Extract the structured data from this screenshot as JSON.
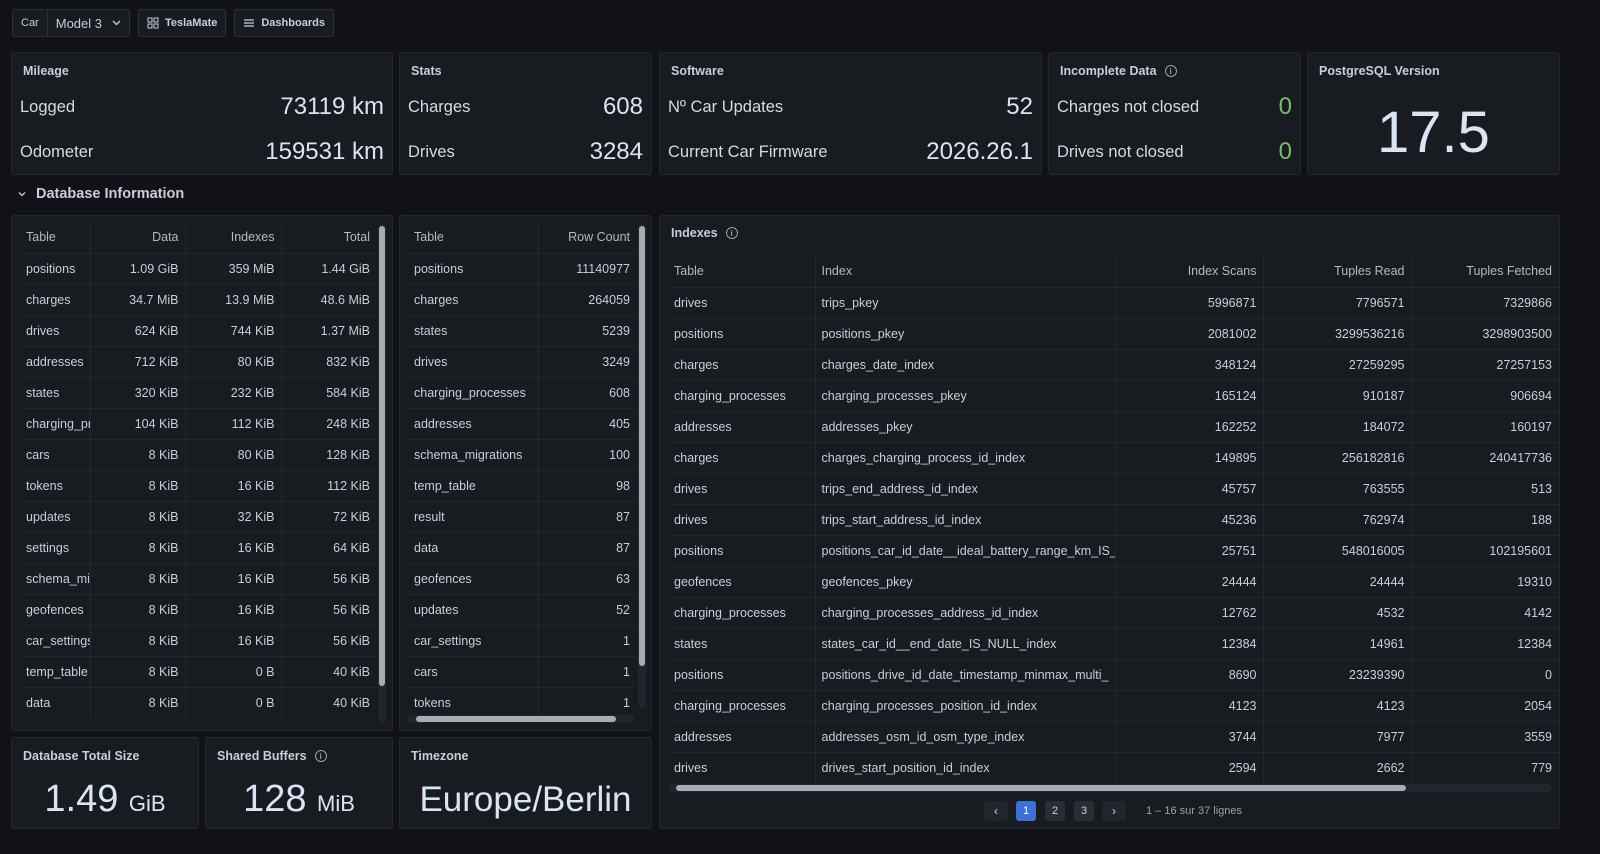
{
  "topbar": {
    "car_label": "Car",
    "car_value": "Model 3",
    "teslamate_label": "TeslaMate",
    "dashboards_label": "Dashboards"
  },
  "mileage": {
    "title": "Mileage",
    "logged_label": "Logged",
    "logged_value": "73119 km",
    "odometer_label": "Odometer",
    "odometer_value": "159531 km"
  },
  "stats": {
    "title": "Stats",
    "charges_label": "Charges",
    "charges_value": "608",
    "drives_label": "Drives",
    "drives_value": "3284"
  },
  "software": {
    "title": "Software",
    "updates_label": "Nº Car Updates",
    "updates_value": "52",
    "firmware_label": "Current Car Firmware",
    "firmware_value": "2026.26.1"
  },
  "incomplete": {
    "title": "Incomplete Data",
    "charges_label": "Charges not closed",
    "charges_value": "0",
    "drives_label": "Drives not closed",
    "drives_value": "0"
  },
  "postgres": {
    "title": "PostgreSQL Version",
    "value": "17.5"
  },
  "section": {
    "title": "Database Information"
  },
  "sizes_table": {
    "headers": [
      "Table",
      "Data",
      "Indexes",
      "Total"
    ],
    "rows": [
      [
        "positions",
        "1.09 GiB",
        "359 MiB",
        "1.44 GiB"
      ],
      [
        "charges",
        "34.7 MiB",
        "13.9 MiB",
        "48.6 MiB"
      ],
      [
        "drives",
        "624 KiB",
        "744 KiB",
        "1.37 MiB"
      ],
      [
        "addresses",
        "712 KiB",
        "80 KiB",
        "832 KiB"
      ],
      [
        "states",
        "320 KiB",
        "232 KiB",
        "584 KiB"
      ],
      [
        "charging_processes",
        "104 KiB",
        "112 KiB",
        "248 KiB"
      ],
      [
        "cars",
        "8 KiB",
        "80 KiB",
        "128 KiB"
      ],
      [
        "tokens",
        "8 KiB",
        "16 KiB",
        "112 KiB"
      ],
      [
        "updates",
        "8 KiB",
        "32 KiB",
        "72 KiB"
      ],
      [
        "settings",
        "8 KiB",
        "16 KiB",
        "64 KiB"
      ],
      [
        "schema_migrations",
        "8 KiB",
        "16 KiB",
        "56 KiB"
      ],
      [
        "geofences",
        "8 KiB",
        "16 KiB",
        "56 KiB"
      ],
      [
        "car_settings",
        "8 KiB",
        "16 KiB",
        "56 KiB"
      ],
      [
        "temp_table",
        "8 KiB",
        "0 B",
        "40 KiB"
      ],
      [
        "data",
        "8 KiB",
        "0 B",
        "40 KiB"
      ]
    ]
  },
  "rows_table": {
    "headers": [
      "Table",
      "Row Count"
    ],
    "rows": [
      [
        "positions",
        "11140977"
      ],
      [
        "charges",
        "264059"
      ],
      [
        "states",
        "5239"
      ],
      [
        "drives",
        "3249"
      ],
      [
        "charging_processes",
        "608"
      ],
      [
        "addresses",
        "405"
      ],
      [
        "schema_migrations",
        "100"
      ],
      [
        "temp_table",
        "98"
      ],
      [
        "result",
        "87"
      ],
      [
        "data",
        "87"
      ],
      [
        "geofences",
        "63"
      ],
      [
        "updates",
        "52"
      ],
      [
        "car_settings",
        "1"
      ],
      [
        "cars",
        "1"
      ],
      [
        "tokens",
        "1"
      ]
    ]
  },
  "indexes": {
    "title": "Indexes",
    "headers": [
      "Table",
      "Index",
      "Index Scans",
      "Tuples Read",
      "Tuples Fetched"
    ],
    "rows": [
      [
        "drives",
        "trips_pkey",
        "5996871",
        "7796571",
        "7329866"
      ],
      [
        "positions",
        "positions_pkey",
        "2081002",
        "3299536216",
        "3298903500"
      ],
      [
        "charges",
        "charges_date_index",
        "348124",
        "27259295",
        "27257153"
      ],
      [
        "charging_processes",
        "charging_processes_pkey",
        "165124",
        "910187",
        "906694"
      ],
      [
        "addresses",
        "addresses_pkey",
        "162252",
        "184072",
        "160197"
      ],
      [
        "charges",
        "charges_charging_process_id_index",
        "149895",
        "256182816",
        "240417736"
      ],
      [
        "drives",
        "trips_end_address_id_index",
        "45757",
        "763555",
        "513"
      ],
      [
        "drives",
        "trips_start_address_id_index",
        "45236",
        "762974",
        "188"
      ],
      [
        "positions",
        "positions_car_id_date__ideal_battery_range_km_IS_",
        "25751",
        "548016005",
        "102195601"
      ],
      [
        "geofences",
        "geofences_pkey",
        "24444",
        "24444",
        "19310"
      ],
      [
        "charging_processes",
        "charging_processes_address_id_index",
        "12762",
        "4532",
        "4142"
      ],
      [
        "states",
        "states_car_id__end_date_IS_NULL_index",
        "12384",
        "14961",
        "12384"
      ],
      [
        "positions",
        "positions_drive_id_date_timestamp_minmax_multi_",
        "8690",
        "23239390",
        "0"
      ],
      [
        "charging_processes",
        "charging_processes_position_id_index",
        "4123",
        "4123",
        "2054"
      ],
      [
        "addresses",
        "addresses_osm_id_osm_type_index",
        "3744",
        "7977",
        "3559"
      ],
      [
        "drives",
        "drives_start_position_id_index",
        "2594",
        "2662",
        "779"
      ]
    ],
    "pages": [
      "1",
      "2",
      "3"
    ],
    "page_info": "1 – 16 sur 37 lignes"
  },
  "db_size": {
    "title": "Database Total Size",
    "value": "1.49",
    "unit": "GiB"
  },
  "buffers": {
    "title": "Shared Buffers",
    "value": "128",
    "unit": "MiB"
  },
  "timezone": {
    "title": "Timezone",
    "value": "Europe/Berlin"
  }
}
